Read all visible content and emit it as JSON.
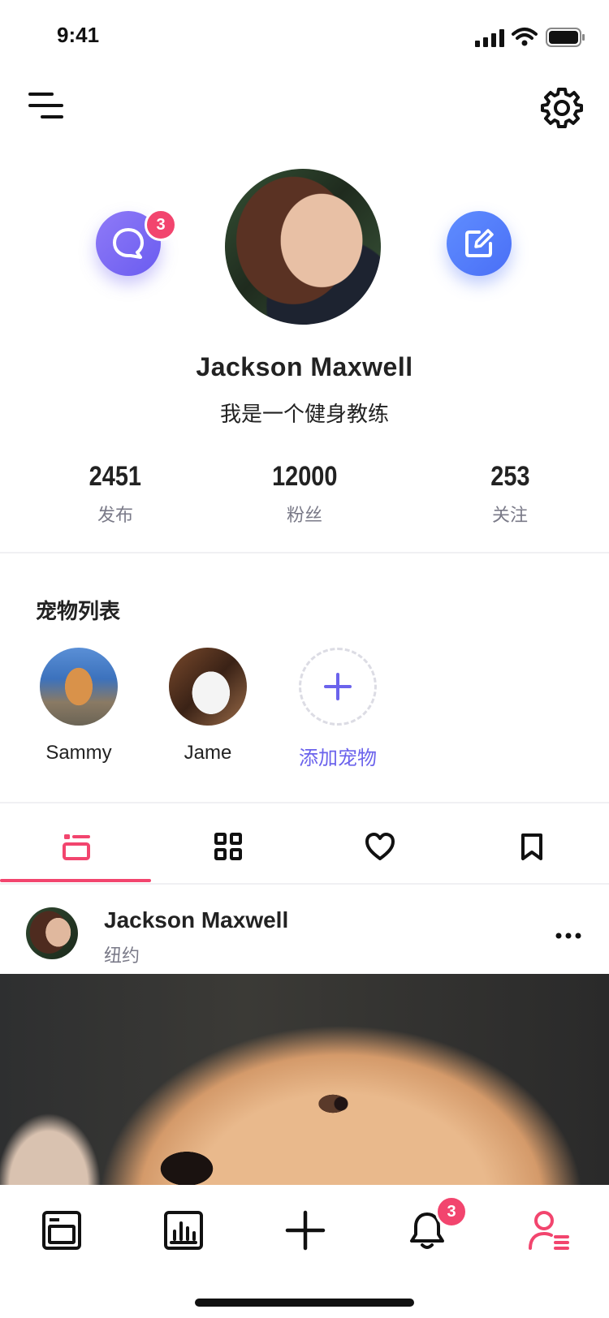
{
  "status_bar": {
    "time": "9:41"
  },
  "profile": {
    "name": "Jackson Maxwell",
    "bio": "我是一个健身教练",
    "messages_badge": "3"
  },
  "stats": [
    {
      "value": "2451",
      "label": "发布"
    },
    {
      "value": "12000",
      "label": "粉丝"
    },
    {
      "value": "253",
      "label": "关注"
    }
  ],
  "pets": {
    "title": "宠物列表",
    "items": [
      {
        "name": "Sammy"
      },
      {
        "name": "Jame"
      }
    ],
    "add_label": "添加宠物"
  },
  "tabs": {
    "active": "posts",
    "icons": [
      "list-icon",
      "grid-icon",
      "heart-icon",
      "bookmark-icon"
    ]
  },
  "post": {
    "user": "Jackson Maxwell",
    "location": "纽约"
  },
  "bottom_nav": {
    "notifications_badge": "3",
    "active": "profile"
  },
  "colors": {
    "accent_pink": "#f2456e",
    "accent_purple": "#6b63ec",
    "chat_button": "#7b6af3",
    "edit_button": "#5a84fb"
  }
}
